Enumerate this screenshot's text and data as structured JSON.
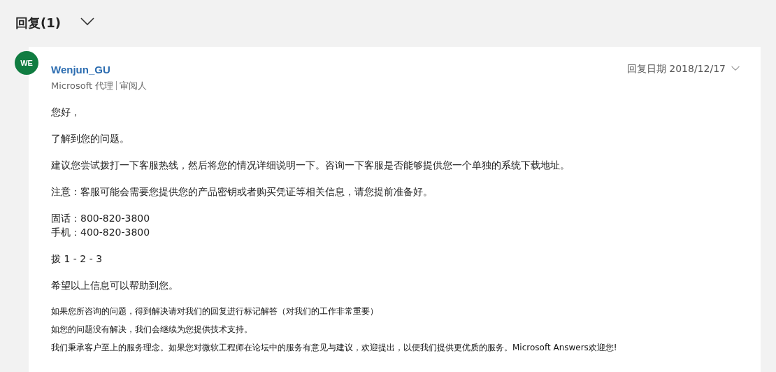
{
  "header": {
    "title": "回复(1)",
    "expanded": true
  },
  "reply": {
    "avatar": "WE",
    "author": "Wenjun_GU",
    "role": "Microsoft 代理",
    "badge": "审阅人",
    "date": "回复日期 2018/12/17",
    "paragraphs": [
      {
        "kind": "normal",
        "lines": [
          "您好，"
        ]
      },
      {
        "kind": "normal",
        "lines": [
          "了解到您的问题。"
        ]
      },
      {
        "kind": "normal",
        "lines": [
          "建议您尝试拨打一下客服热线，然后将您的情况详细说明一下。咨询一下客服是否能够提供您一个单独的系统下载地址。"
        ]
      },
      {
        "kind": "normal",
        "lines": [
          "注意：客服可能会需要您提供您的产品密钥或者购买凭证等相关信息，请您提前准备好。"
        ]
      },
      {
        "kind": "normal",
        "lines": [
          "固话：800-820-3800",
          "手机：400-820-3800"
        ]
      },
      {
        "kind": "normal",
        "lines": [
          "拨 1 - 2 - 3"
        ]
      },
      {
        "kind": "normal",
        "lines": [
          "希望以上信息可以帮助到您。"
        ]
      },
      {
        "kind": "small",
        "lines": [
          "如果您所咨询的问题，得到解决请对我们的回复进行标记解答（对我们的工作非常重要）"
        ]
      },
      {
        "kind": "small",
        "lines": [
          "如您的问题没有解决，我们会继续为您提供技术支持。"
        ]
      },
      {
        "kind": "small",
        "lines": [
          "我们秉承客户至上的服务理念。如果您对微软工程师在论坛中的服务有意见与建议，欢迎提出，以便我们提供更优质的服务。Microsoft Answers欢迎您!"
        ]
      }
    ]
  }
}
